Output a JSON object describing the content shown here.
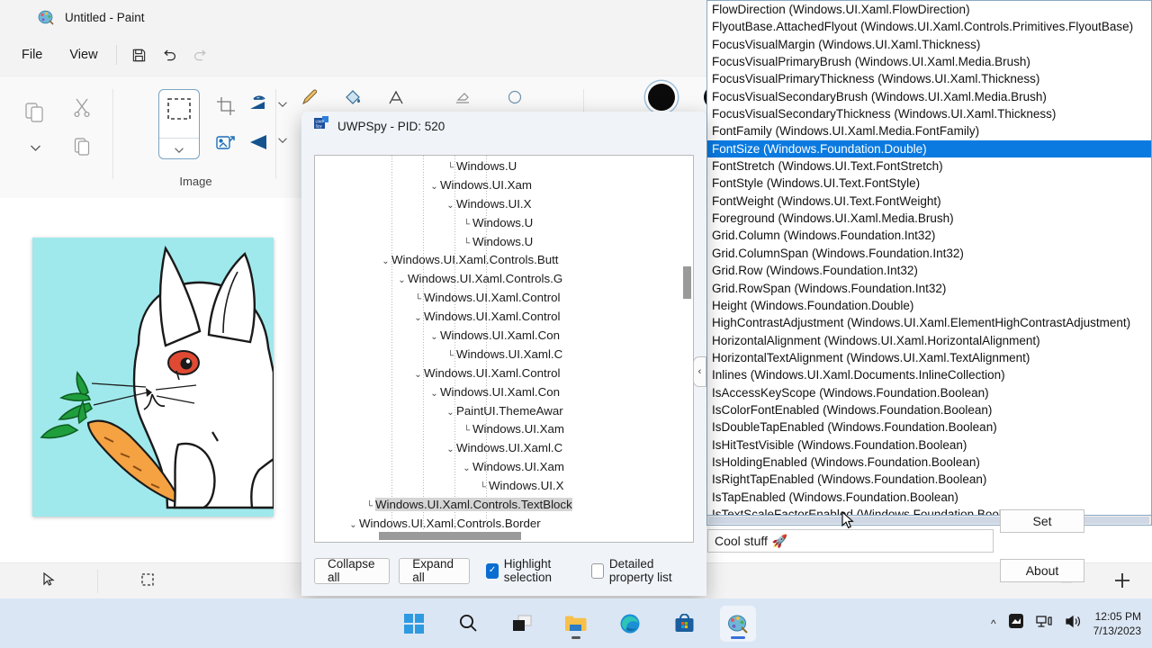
{
  "paint": {
    "title": "Untitled - Paint",
    "app_icon": "paint-palette-icon",
    "menus": [
      "File",
      "View"
    ],
    "quick_actions": [
      "save-icon",
      "undo-icon",
      "redo-icon"
    ],
    "ribbon": {
      "clipboard": {
        "icons": [
          "paste-icon",
          "cut-icon",
          "copy-icon",
          "chevron-down-icon"
        ]
      },
      "cool_stuff_label": "Cool stuff",
      "cool_stuff_emoji": "🚀",
      "image_group_label": "Image",
      "image_icons": [
        "select-rectangle-icon",
        "crop-icon",
        "rotate-icon",
        "resize-icon",
        "flip-icon"
      ],
      "tools": [
        "pencil-icon",
        "fill-icon",
        "text-icon",
        "eraser-icon",
        "shape-icon"
      ],
      "color_swatch": "#000000"
    },
    "canvas": {
      "background_color": "#9fe9ec",
      "drawing": "rabbit-with-carrot"
    },
    "statusbar": {
      "cursor_icon": "cursor-arrow-icon",
      "selection_icon": "selection-size-icon"
    },
    "zoom_controls": {
      "minus": "−",
      "plus": "+"
    }
  },
  "spy": {
    "title": "UWPSpy - PID: 520",
    "icon": "uwpspy-icon",
    "tree": [
      {
        "indent": 8,
        "chevron": "",
        "label": "Windows.U"
      },
      {
        "indent": 7,
        "chevron": "v",
        "label": "Windows.UI.Xam"
      },
      {
        "indent": 8,
        "chevron": "v",
        "label": "Windows.UI.X"
      },
      {
        "indent": 9,
        "chevron": "",
        "label": "Windows.U"
      },
      {
        "indent": 9,
        "chevron": "",
        "label": "Windows.U"
      },
      {
        "indent": 4,
        "chevron": "v",
        "label": "Windows.UI.Xaml.Controls.Butt"
      },
      {
        "indent": 5,
        "chevron": "v",
        "label": "Windows.UI.Xaml.Controls.G"
      },
      {
        "indent": 6,
        "chevron": "",
        "label": "Windows.UI.Xaml.Control"
      },
      {
        "indent": 6,
        "chevron": "v",
        "label": "Windows.UI.Xaml.Control"
      },
      {
        "indent": 7,
        "chevron": "v",
        "label": "Windows.UI.Xaml.Con"
      },
      {
        "indent": 8,
        "chevron": "",
        "label": "Windows.UI.Xaml.C"
      },
      {
        "indent": 6,
        "chevron": "v",
        "label": "Windows.UI.Xaml.Control"
      },
      {
        "indent": 7,
        "chevron": "v",
        "label": "Windows.UI.Xaml.Con"
      },
      {
        "indent": 8,
        "chevron": "v",
        "label": "PaintUI.ThemeAwar"
      },
      {
        "indent": 9,
        "chevron": "",
        "label": "Windows.UI.Xam"
      },
      {
        "indent": 8,
        "chevron": "v",
        "label": "Windows.UI.Xaml.C"
      },
      {
        "indent": 9,
        "chevron": "v",
        "label": "Windows.UI.Xam"
      },
      {
        "indent": 10,
        "chevron": "",
        "label": "Windows.UI.X"
      },
      {
        "indent": 3,
        "chevron": "",
        "label": "Windows.UI.Xaml.Controls.TextBlock",
        "selected": true
      },
      {
        "indent": 2,
        "chevron": "v",
        "label": "Windows.UI.Xaml.Controls.Border"
      }
    ],
    "buttons": {
      "collapse_all": "Collapse all",
      "expand_all": "Expand all"
    },
    "checkboxes": [
      {
        "label": "Highlight selection",
        "checked": true
      },
      {
        "label": "Detailed property list",
        "checked": false
      }
    ]
  },
  "properties": {
    "selected_index": 8,
    "items": [
      "FlowDirection (Windows.UI.Xaml.FlowDirection)",
      "FlyoutBase.AttachedFlyout (Windows.UI.Xaml.Controls.Primitives.FlyoutBase)",
      "FocusVisualMargin (Windows.UI.Xaml.Thickness)",
      "FocusVisualPrimaryBrush (Windows.UI.Xaml.Media.Brush)",
      "FocusVisualPrimaryThickness (Windows.UI.Xaml.Thickness)",
      "FocusVisualSecondaryBrush (Windows.UI.Xaml.Media.Brush)",
      "FocusVisualSecondaryThickness (Windows.UI.Xaml.Thickness)",
      "FontFamily (Windows.UI.Xaml.Media.FontFamily)",
      "FontSize (Windows.Foundation.Double)",
      "FontStretch (Windows.UI.Text.FontStretch)",
      "FontStyle (Windows.UI.Text.FontStyle)",
      "FontWeight (Windows.UI.Text.FontWeight)",
      "Foreground (Windows.UI.Xaml.Media.Brush)",
      "Grid.Column (Windows.Foundation.Int32)",
      "Grid.ColumnSpan (Windows.Foundation.Int32)",
      "Grid.Row (Windows.Foundation.Int32)",
      "Grid.RowSpan (Windows.Foundation.Int32)",
      "Height (Windows.Foundation.Double)",
      "HighContrastAdjustment (Windows.UI.Xaml.ElementHighContrastAdjustment)",
      "HorizontalAlignment (Windows.UI.Xaml.HorizontalAlignment)",
      "HorizontalTextAlignment (Windows.UI.Xaml.TextAlignment)",
      "Inlines (Windows.UI.Xaml.Documents.InlineCollection)",
      "IsAccessKeyScope (Windows.Foundation.Boolean)",
      "IsColorFontEnabled (Windows.Foundation.Boolean)",
      "IsDoubleTapEnabled (Windows.Foundation.Boolean)",
      "IsHitTestVisible (Windows.Foundation.Boolean)",
      "IsHoldingEnabled (Windows.Foundation.Boolean)",
      "IsRightTapEnabled (Windows.Foundation.Boolean)",
      "IsTapEnabled (Windows.Foundation.Boolean)",
      "IsTextScaleFactorEnabled (Windows.Foundation.Boolean)"
    ],
    "collapse_handle": "‹",
    "selection_color": "#0a7ae0"
  },
  "value_editor": {
    "value_text": "Cool stuff",
    "value_emoji": "🚀",
    "set_button": "Set",
    "about_button": "About"
  },
  "taskbar": {
    "items": [
      {
        "name": "start-icon"
      },
      {
        "name": "search-icon"
      },
      {
        "name": "task-view-icon"
      },
      {
        "name": "file-explorer-icon"
      },
      {
        "name": "edge-icon"
      },
      {
        "name": "microsoft-store-icon"
      },
      {
        "name": "paint-icon"
      }
    ],
    "tray": {
      "chevron": "^",
      "icons": [
        "hidden-icons-icon",
        "network-icon",
        "volume-icon"
      ],
      "time": "12:05 PM",
      "date": "7/13/2023"
    }
  }
}
